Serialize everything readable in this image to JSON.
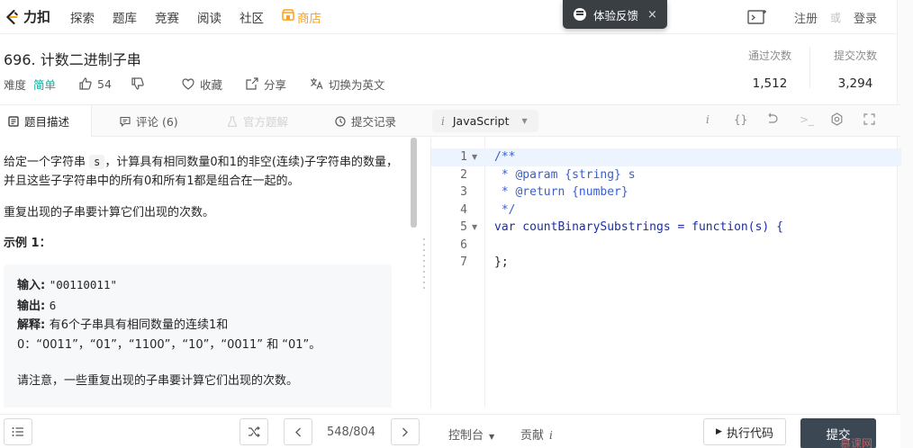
{
  "nav": {
    "logo_text": "力扣",
    "items": [
      "探索",
      "题库",
      "竞赛",
      "阅读",
      "社区"
    ],
    "store_label": "商店",
    "register": "注册",
    "or": "或",
    "login": "登录"
  },
  "toast": {
    "label": "体验反馈",
    "close": "×"
  },
  "problem": {
    "title": "696. 计数二进制子串",
    "difficulty_label": "难度",
    "difficulty": "简单",
    "likes": "54",
    "favorite": "收藏",
    "share": "分享",
    "switch_lang": "切换为英文"
  },
  "stats": {
    "pass_label": "通过次数",
    "pass_value": "1,512",
    "submit_label": "提交次数",
    "submit_value": "3,294"
  },
  "tabs": {
    "description": "题目描述",
    "comments": "评论 (6)",
    "solution": "官方题解",
    "submissions": "提交记录"
  },
  "editor_toolbar": {
    "language": "JavaScript",
    "info": "i",
    "braces": "{}",
    "console_glyph": ">_"
  },
  "description": {
    "p1_before": "给定一个字符串 ",
    "p1_code": "s",
    "p1_after": "，计算具有相同数量0和1的非空(连续)子字符串的数量，并且这些子字符串中的所有0和所有1都是组合在一起的。",
    "p2": "重复出现的子串要计算它们出现的次数。",
    "example_title": "示例 1：",
    "ex_input_label": "输入: ",
    "ex_input": "\"00110011\"",
    "ex_output_label": "输出: ",
    "ex_output": "6",
    "ex_explain_label": "解释: ",
    "ex_explain": "有6个子串具有相同数量的连续1和",
    "ex_explain_2": "0：“0011”，“01”，“1100”，“10”，“0011” 和 “01”。",
    "ex_note": "请注意，一些重复出现的子串要计算它们出现的次数。"
  },
  "code": {
    "lines": [
      {
        "n": "1",
        "text": "/**"
      },
      {
        "n": "2",
        "text": " * @param {string} s"
      },
      {
        "n": "3",
        "text": " * @return {number}"
      },
      {
        "n": "4",
        "text": " */"
      },
      {
        "n": "5",
        "text": "var countBinarySubstrings = function(s) {"
      },
      {
        "n": "6",
        "text": ""
      },
      {
        "n": "7",
        "text": "};"
      }
    ]
  },
  "bottom": {
    "pager": "548/804",
    "console": "控制台",
    "contribute": "贡献",
    "contribute_info": "i",
    "run": "执行代码",
    "submit": "提交",
    "watermark": "慕课网"
  },
  "colors": {
    "accent_green": "#00af9b",
    "store_orange": "#ffa116",
    "submit_dark": "#3b4753"
  }
}
